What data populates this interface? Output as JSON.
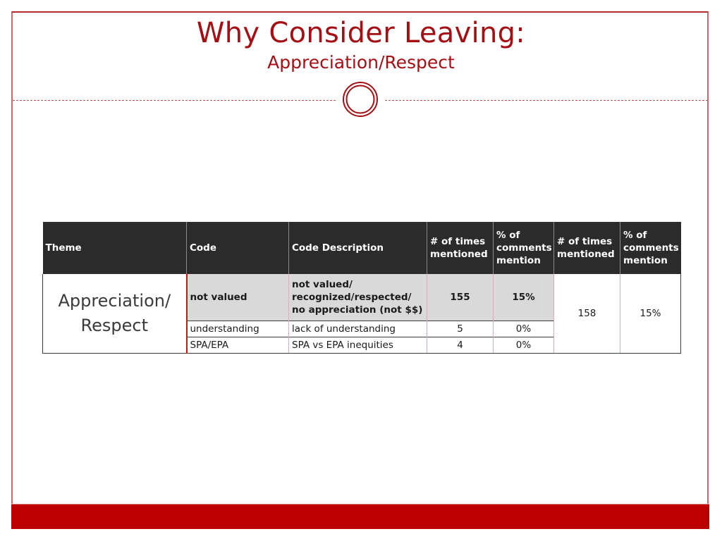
{
  "slide": {
    "title": "Why Consider Leaving:",
    "subtitle": "Appreciation/Respect",
    "colors": {
      "accent": "#a50f14",
      "bottom_bar": "#bc0000",
      "header_bg": "#2b2b2b",
      "highlight_row_bg": "#d9d9d9"
    },
    "ornament_icon": "double-circle-icon"
  },
  "table": {
    "headers": [
      "Theme",
      "Code",
      "Code Description",
      "# of times mentioned",
      "% of comments mention",
      "# of times mentioned",
      "% of comments mention"
    ],
    "theme": "Appreciation/ Respect",
    "rows": [
      {
        "code": "not valued",
        "description": "not valued/ recognized/respected/ no appreciation (not $$)",
        "times_mentioned": "155",
        "percent_mention": "15%",
        "highlighted": true
      },
      {
        "code": "understanding",
        "description": "lack of understanding",
        "times_mentioned": "5",
        "percent_mention": "0%",
        "highlighted": false
      },
      {
        "code": "SPA/EPA",
        "description": "SPA vs EPA inequities",
        "times_mentioned": "4",
        "percent_mention": "0%",
        "highlighted": false
      }
    ],
    "theme_total": {
      "times_mentioned": "158",
      "percent_mention": "15%"
    }
  }
}
